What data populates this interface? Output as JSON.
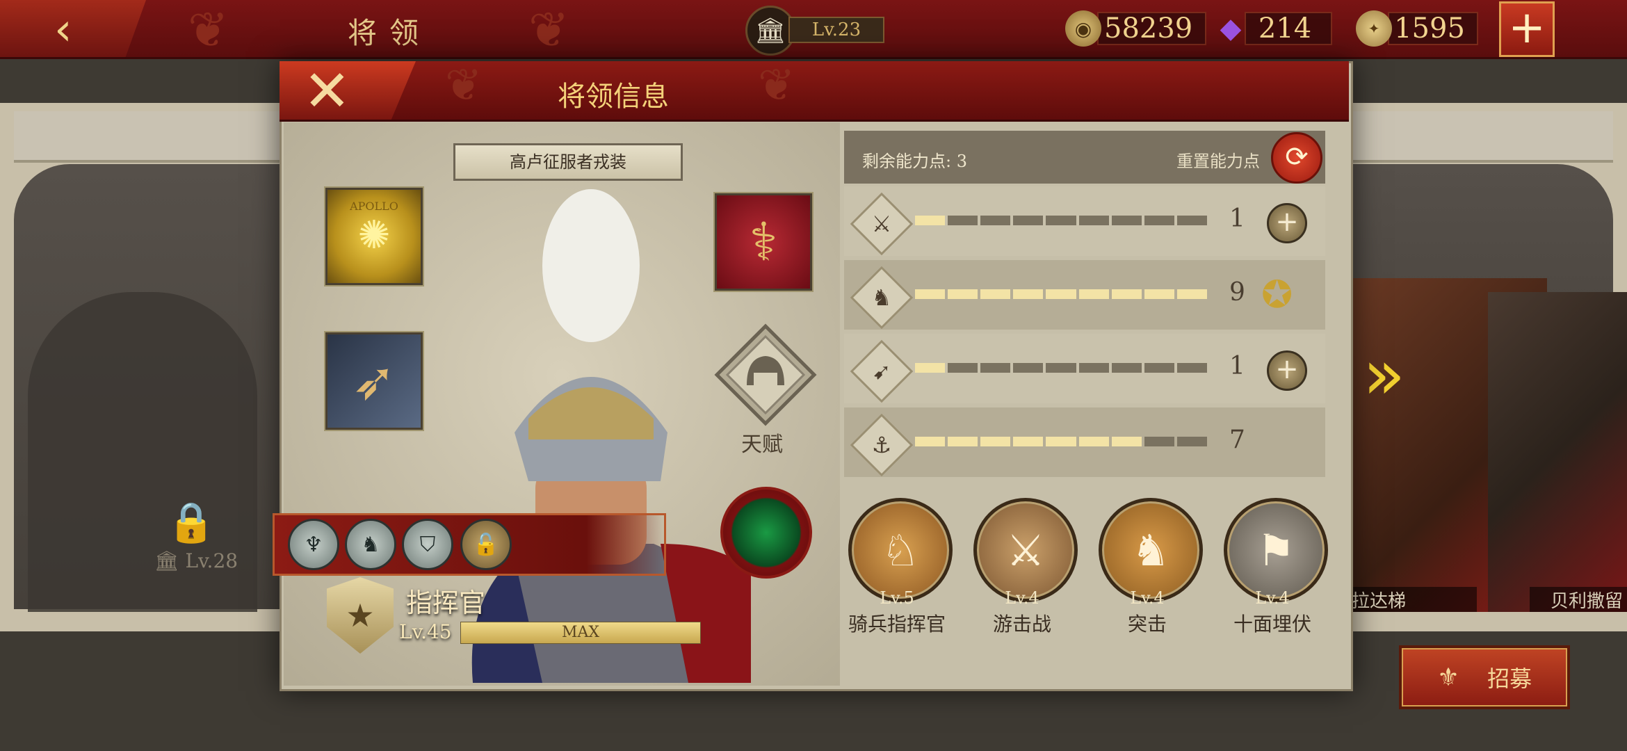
{
  "topbar": {
    "back_icon": "arrow-left-icon",
    "title": "将领",
    "town_level": "Lv.23",
    "resources": [
      {
        "icon": "coin-icon",
        "value": "58239",
        "color": "#c9a35a"
      },
      {
        "icon": "gem-icon",
        "value": "214",
        "color": "#8a4ad0"
      },
      {
        "icon": "spqr-eagle-icon",
        "value": "1595",
        "color": "#d8b46a"
      }
    ],
    "add_label": "+"
  },
  "background": {
    "locked_level": "Lv.28",
    "right_hero_1_name": "拉达梯",
    "right_hero_2_name": "贝利撒留",
    "recruit_label": "招募"
  },
  "modal": {
    "title": "将领信息",
    "close_label": "✕",
    "costume_label": "高卢征服者戎装",
    "equipment": [
      {
        "name": "apollo-banner",
        "label": "APOLLO"
      },
      {
        "name": "caduceus-relic",
        "label": ""
      },
      {
        "name": "spear-weapon",
        "label": ""
      }
    ],
    "talent_label": "天赋",
    "commander": {
      "rank": "指挥官",
      "level": "Lv.45",
      "xp_label": "MAX",
      "xp_fraction": 1.0
    },
    "ability_points": {
      "remaining_label": "剩余能力点: 3",
      "reset_label": "重置能力点"
    },
    "stats": [
      {
        "icon": "sword-icon",
        "value": "1",
        "filled": 1,
        "segments": 9,
        "action": "plus"
      },
      {
        "icon": "horse-icon",
        "value": "9",
        "filled": 9,
        "segments": 9,
        "action": "star"
      },
      {
        "icon": "bow-icon",
        "value": "1",
        "filled": 1,
        "segments": 9,
        "action": "plus"
      },
      {
        "icon": "anchor-icon",
        "value": "7",
        "filled": 7,
        "segments": 9,
        "action": "none"
      }
    ],
    "skills": [
      {
        "level": "Lv.5",
        "name": "骑兵指挥官",
        "icon": "horse-head-icon",
        "bg": "#c48a3a"
      },
      {
        "level": "Lv.4",
        "name": "游击战",
        "icon": "cavalry-archers-icon",
        "bg": "#b47a44"
      },
      {
        "level": "Lv.4",
        "name": "突击",
        "icon": "charging-rider-icon",
        "bg": "#c8883a"
      },
      {
        "level": "Lv.4",
        "name": "十面埋伏",
        "icon": "ambush-soldiers-icon",
        "bg": "#8c8478"
      }
    ]
  }
}
